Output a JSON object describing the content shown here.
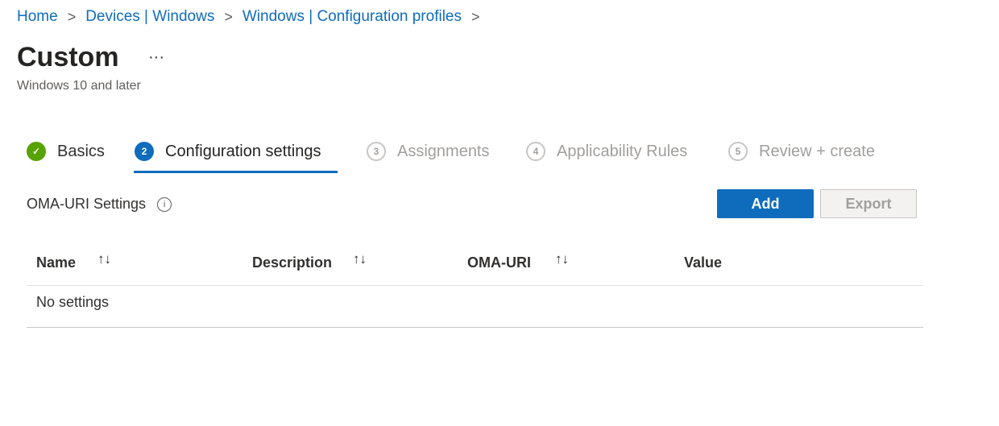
{
  "breadcrumb": [
    "Home",
    "Devices | Windows",
    "Windows | Configuration profiles"
  ],
  "title": "Custom",
  "more_label": "···",
  "subtitle": "Windows 10 and later",
  "steps": [
    {
      "num": "✓",
      "label": "Basics",
      "state": "done"
    },
    {
      "num": "2",
      "label": "Configuration settings",
      "state": "current"
    },
    {
      "num": "3",
      "label": "Assignments",
      "state": "future"
    },
    {
      "num": "4",
      "label": "Applicability Rules",
      "state": "future"
    },
    {
      "num": "5",
      "label": "Review + create",
      "state": "future"
    }
  ],
  "section": {
    "label": "OMA-URI Settings",
    "info": "i"
  },
  "buttons": {
    "add": "Add",
    "export": "Export"
  },
  "table": {
    "columns": [
      "Name",
      "Description",
      "OMA-URI",
      "Value"
    ],
    "sort_icon": "↑↓",
    "empty": "No settings"
  },
  "colors": {
    "accent": "#0f6cbd",
    "success": "#57a300"
  }
}
